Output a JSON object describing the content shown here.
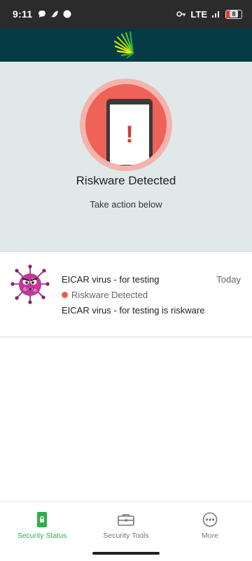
{
  "status_bar": {
    "time": "9:11",
    "network": "LTE",
    "battery": "8"
  },
  "app_bar": {
    "logo_icon": "lookout-fan-logo-icon"
  },
  "hero": {
    "title": "Riskware Detected",
    "subtitle": "Take action below",
    "icon": "phone-alert-icon",
    "alert_symbol": "!"
  },
  "threats": [
    {
      "name": "EICAR virus - for testing",
      "date": "Today",
      "status": "Riskware Detected",
      "description": "EICAR virus - for testing is riskware",
      "icon": "virus-icon"
    }
  ],
  "bottom_nav": {
    "items": [
      {
        "label": "Security Status",
        "icon": "lock-icon",
        "active": true
      },
      {
        "label": "Security Tools",
        "icon": "toolbox-icon",
        "active": false
      },
      {
        "label": "More",
        "icon": "more-icon",
        "active": false
      }
    ]
  },
  "colors": {
    "app_bar": "#053b45",
    "accent": "#2eae4a",
    "alert": "#ee6257",
    "hero_bg": "#e1e8ea"
  }
}
